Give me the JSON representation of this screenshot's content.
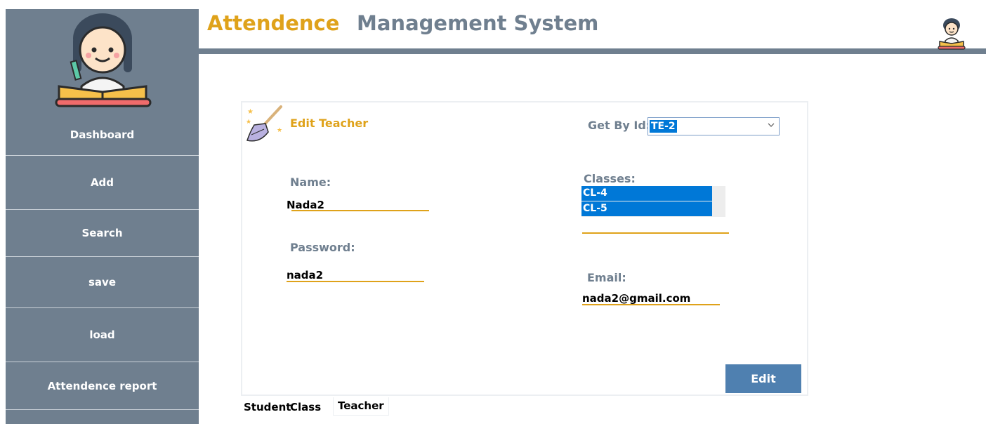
{
  "header": {
    "title_part1": "Attendence",
    "title_part2": "Management System",
    "accent_color": "#dfa21a",
    "slate_color": "#6f7f8f"
  },
  "sidebar": {
    "logo_icon": "student-reading-icon",
    "items": [
      {
        "label": "Dashboard"
      },
      {
        "label": "Add"
      },
      {
        "label": "Search"
      },
      {
        "label": "save"
      },
      {
        "label": "load"
      },
      {
        "label": "Attendence report"
      }
    ]
  },
  "form": {
    "icon": "magic-broom-icon",
    "title": "Edit Teacher",
    "get_by_id_label": "Get By Id:",
    "get_by_id_value": "TE-2",
    "name_label": "Name:",
    "name_value": "Nada2",
    "password_label": "Password:",
    "password_value": "nada2",
    "classes_label": "Classes:",
    "classes": [
      "CL-4",
      "CL-5"
    ],
    "email_label": "Email:",
    "email_value": "nada2@gmail.com",
    "edit_button": "Edit"
  },
  "tabs": [
    {
      "label": "Student"
    },
    {
      "label": "Class"
    },
    {
      "label": "Teacher",
      "active": true
    }
  ]
}
